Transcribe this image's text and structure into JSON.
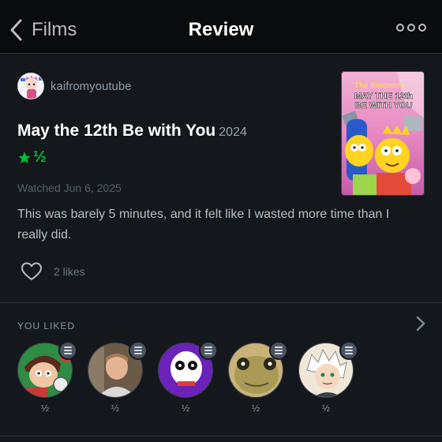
{
  "nav": {
    "back_label": "Films",
    "title": "Review"
  },
  "author": {
    "username": "kaifromyoutube"
  },
  "film": {
    "title": "May the 12th Be with You",
    "year": "2024"
  },
  "rating": {
    "stars": 1.5,
    "display": "★½"
  },
  "review": {
    "watched": "Watched Jun 6, 2025",
    "text": "This was barely 5 minutes, and it felt like I wasted more time than I really did."
  },
  "likes": {
    "count_label": "2 likes"
  },
  "you_liked": {
    "label": "YOU LIKED",
    "friends": [
      {
        "rating": "½"
      },
      {
        "rating": "½"
      },
      {
        "rating": "½"
      },
      {
        "rating": "½"
      },
      {
        "rating": "½"
      }
    ]
  },
  "colors": {
    "accent_green": "#00c030",
    "background": "#14181c",
    "topbar": "#0a0b0c"
  },
  "icons": [
    "chevron-left-icon",
    "more-icon",
    "star-icon",
    "heart-icon",
    "chevron-right-icon",
    "review-list-icon"
  ]
}
